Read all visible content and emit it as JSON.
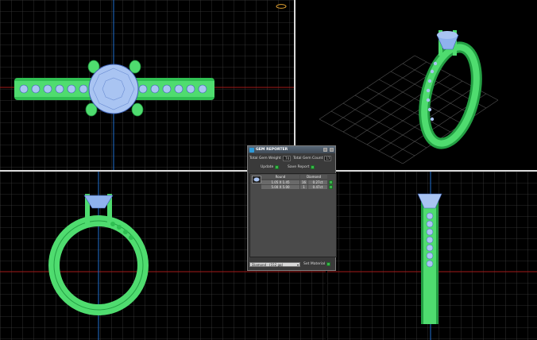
{
  "gem_reporter": {
    "title": "GEM REPORTER",
    "total_gem_weight_label": "Total Gem Weight",
    "total_gem_weight_value": ".74",
    "total_gem_count_label": "Total Gem Count",
    "total_gem_count_value": "17",
    "update_label": "Update",
    "save_report_label": "Save Report",
    "columns": {
      "shape": "Round",
      "material": "Diamond"
    },
    "rows": [
      {
        "size": "1.05 X 1.45",
        "count": "16",
        "weight": "0.27ct"
      },
      {
        "size": "5.00 X 5.00",
        "count": "1",
        "weight": "0.47ct"
      }
    ],
    "material_select": "Diamond - (152 gq)",
    "set_material_label": "Set Material"
  },
  "colors": {
    "metal": "#4fdc6f",
    "metal_dark": "#24a044",
    "gem": "#a9c4f2",
    "grid": "#3d3d3d",
    "axis_red": "#c0201c",
    "axis_blue": "#1f6fd1"
  },
  "viewports": [
    "top-view",
    "perspective-view",
    "front-view",
    "right-view"
  ]
}
